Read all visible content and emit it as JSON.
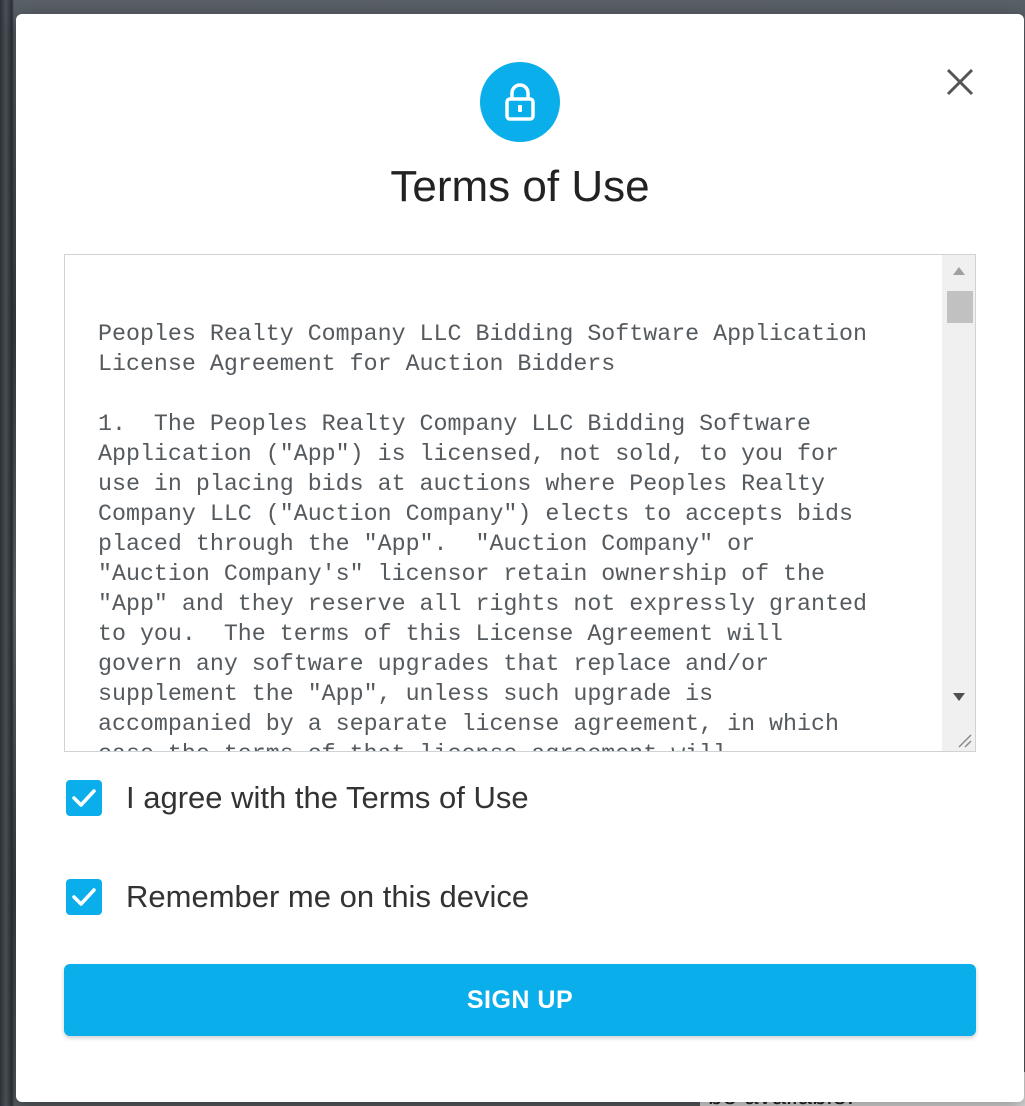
{
  "modal": {
    "title": "Terms of Use",
    "lock_icon": "lock-icon",
    "close_icon": "close-icon",
    "terms_text": "Peoples Realty Company LLC Bidding Software Application\nLicense Agreement for Auction Bidders\n\n1.  The Peoples Realty Company LLC Bidding Software\nApplication (\"App\") is licensed, not sold, to you for\nuse in placing bids at auctions where Peoples Realty\nCompany LLC (\"Auction Company\") elects to accepts bids\nplaced through the \"App\".  \"Auction Company\" or\n\"Auction Company's\" licensor retain ownership of the\n\"App\" and they reserve all rights not expressly granted\nto you.  The terms of this License Agreement will\ngovern any software upgrades that replace and/or\nsupplement the \"App\", unless such upgrade is\naccompanied by a separate license agreement, in which\ncase the terms of that license agreement will",
    "agree_label": "I agree with the Terms of Use",
    "agree_checked": true,
    "remember_label": "Remember me on this device",
    "remember_checked": true,
    "signup_label": "SIGN UP"
  },
  "background": {
    "partial_text": "be available."
  },
  "colors": {
    "accent": "#0aaeea",
    "title_text": "#222222",
    "terms_text": "#555a5e"
  }
}
